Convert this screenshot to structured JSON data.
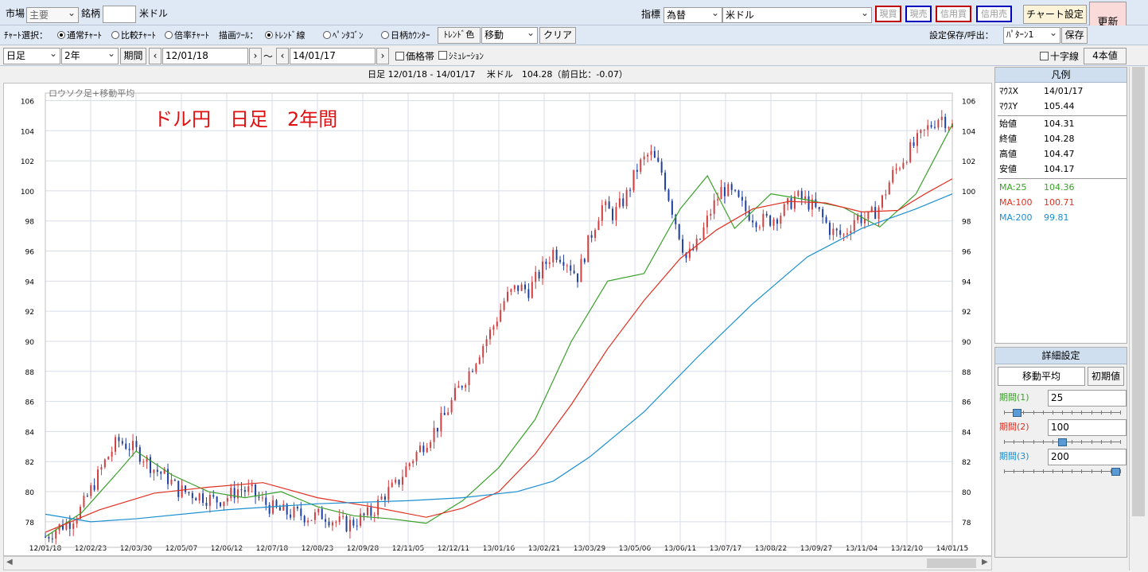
{
  "toolbar1": {
    "market_label": "市場",
    "market_value": "主要",
    "symbol_label": "銘柄",
    "symbol_code": "",
    "symbol_name": "米ドル",
    "indicator_label": "指標",
    "indicator_type": "為替",
    "indicator_value": "米ドル",
    "order_buttons": [
      {
        "label": "現買",
        "color": "#c00000"
      },
      {
        "label": "現売",
        "color": "#0000c0"
      },
      {
        "label": "信用買",
        "color": "#c00000"
      },
      {
        "label": "信用売",
        "color": "#0000c0"
      }
    ],
    "chart_settings": "チャート設定",
    "refresh": "更新"
  },
  "toolbar2": {
    "chart_select_label": "ﾁｬｰﾄ選択：",
    "chart_types": [
      "通常ﾁｬｰﾄ",
      "比較ﾁｬｰﾄ",
      "倍率ﾁｬｰﾄ"
    ],
    "draw_tool_label": "描画ﾂｰﾙ：",
    "draw_tools": [
      "ﾄﾚﾝﾄﾞ線",
      "ﾍﾟﾝﾀｺﾞﾝ",
      "日柄ｶｳﾝﾀｰ"
    ],
    "trend_color": "ﾄﾚﾝﾄﾞ色",
    "move_value": "移動",
    "clear": "クリア",
    "save_load_label": "設定保存/呼出：",
    "pattern_value": "ﾊﾟﾀｰﾝ1",
    "save": "保存"
  },
  "toolbar3": {
    "timeframe": "日足",
    "range": "2年",
    "period_button": "期間",
    "date_from": "12/01/18",
    "date_to": "14/01/17",
    "tilde": "〜",
    "price_band": "価格帯",
    "simulation": "ｼﾐｭﾚｰｼｮﾝ",
    "crosshair": "十字線",
    "four_values": "4本値"
  },
  "chart": {
    "header": "日足 12/01/18 - 14/01/17 　米ドル　104.28（前日比：-0.07）",
    "corner_label": "ロウソク足+移動平均",
    "annotation": "ドル円　日足　2年間",
    "annotation_color": "#e01010"
  },
  "legend": {
    "title": "凡例",
    "mouse_x_label": "ﾏｳｽX",
    "mouse_x": "14/01/17",
    "mouse_y_label": "ﾏｳｽY",
    "mouse_y": "105.44",
    "open_label": "始値",
    "open": "104.31",
    "close_label": "終値",
    "close": "104.28",
    "high_label": "高値",
    "high": "104.47",
    "low_label": "安値",
    "low": "104.17",
    "ma25_label": "MA:25",
    "ma25": "104.36",
    "ma100_label": "MA:100",
    "ma100": "100.71",
    "ma200_label": "MA:200",
    "ma200": "99.81"
  },
  "settings": {
    "title": "詳細設定",
    "tab": "移動平均",
    "reset": "初期値",
    "p1_label": "期間(1)",
    "p1": "25",
    "p2_label": "期間(2)",
    "p2": "100",
    "p3_label": "期間(3)",
    "p3": "200",
    "p1_level": 0.08,
    "p2_level": 0.5,
    "p3_level": 1.0
  },
  "colors": {
    "ma25": "#3aa02a",
    "ma100": "#e03020",
    "ma200": "#1a8fd0",
    "candle_up": "#d04040",
    "candle_down": "#2040a0"
  },
  "chart_data": {
    "type": "line",
    "title": "",
    "y_ticks": [
      "106",
      "104",
      "102",
      "100",
      "98",
      "96",
      "94",
      "92",
      "90",
      "88",
      "86",
      "84",
      "82",
      "80",
      "78"
    ],
    "ylim": [
      76.3,
      106.5
    ],
    "x_ticks": [
      "12/01/18",
      "12/02/23",
      "12/03/30",
      "12/05/07",
      "12/06/12",
      "12/07/18",
      "12/08/23",
      "12/09/28",
      "12/11/05",
      "12/12/11",
      "13/01/16",
      "13/02/21",
      "13/03/29",
      "13/05/06",
      "13/06/11",
      "13/07/17",
      "13/08/22",
      "13/09/27",
      "13/11/04",
      "13/12/10",
      "14/01/15"
    ],
    "grid": true,
    "series": [
      {
        "name": "MA:25",
        "x": [
          0,
          0.04,
          0.08,
          0.1,
          0.14,
          0.18,
          0.22,
          0.26,
          0.3,
          0.34,
          0.38,
          0.42,
          0.46,
          0.5,
          0.54,
          0.58,
          0.62,
          0.66,
          0.7,
          0.73,
          0.76,
          0.8,
          0.84,
          0.88,
          0.92,
          0.96,
          1.0
        ],
        "values": [
          77.0,
          78.6,
          81.3,
          82.7,
          81.1,
          80.0,
          79.6,
          80.0,
          79.0,
          78.4,
          78.2,
          77.9,
          79.4,
          81.6,
          84.8,
          90.0,
          94.0,
          94.5,
          98.8,
          101.0,
          97.5,
          99.8,
          99.4,
          98.9,
          97.6,
          99.8,
          104.4
        ]
      },
      {
        "name": "MA:100",
        "x": [
          0,
          0.06,
          0.12,
          0.18,
          0.24,
          0.3,
          0.36,
          0.42,
          0.46,
          0.5,
          0.54,
          0.58,
          0.62,
          0.66,
          0.7,
          0.74,
          0.78,
          0.82,
          0.86,
          0.9,
          0.94,
          0.97,
          1.0
        ],
        "values": [
          77.3,
          78.8,
          79.9,
          80.3,
          80.6,
          79.6,
          79.0,
          78.3,
          78.9,
          80.0,
          82.5,
          85.8,
          89.5,
          92.7,
          95.5,
          97.4,
          98.8,
          99.3,
          99.2,
          98.6,
          98.7,
          99.8,
          100.8
        ]
      },
      {
        "name": "MA:200",
        "x": [
          0,
          0.05,
          0.1,
          0.2,
          0.3,
          0.4,
          0.46,
          0.52,
          0.56,
          0.6,
          0.66,
          0.72,
          0.78,
          0.84,
          0.9,
          0.96,
          1.0
        ],
        "values": [
          78.5,
          78.0,
          78.2,
          78.8,
          79.2,
          79.4,
          79.6,
          80.0,
          80.7,
          82.3,
          85.3,
          89.0,
          92.5,
          95.6,
          97.5,
          98.8,
          99.8
        ]
      }
    ],
    "candles_approx": [
      77.0,
      77.6,
      78.0,
      78.9,
      80.5,
      82.1,
      83.4,
      83.0,
      82.4,
      81.5,
      81.0,
      80.1,
      79.9,
      79.7,
      79.4,
      79.6,
      80.2,
      80.0,
      79.3,
      78.8,
      78.6,
      78.5,
      78.3,
      78.5,
      78.0,
      77.8,
      78.2,
      78.6,
      79.8,
      80.4,
      81.8,
      82.9,
      83.9,
      85.0,
      86.6,
      87.9,
      89.5,
      90.9,
      92.8,
      93.6,
      93.4,
      94.7,
      96.0,
      95.5,
      94.3,
      96.8,
      99.0,
      98.4,
      99.6,
      101.6,
      102.5,
      101.2,
      98.3,
      95.5,
      96.5,
      98.6,
      100.2,
      99.6,
      98.6,
      98.0,
      98.1,
      98.6,
      99.6,
      99.3,
      98.5,
      97.3,
      97.0,
      98.3,
      98.1,
      99.0,
      101.0,
      102.2,
      103.2,
      104.2,
      105.0,
      104.3
    ]
  }
}
